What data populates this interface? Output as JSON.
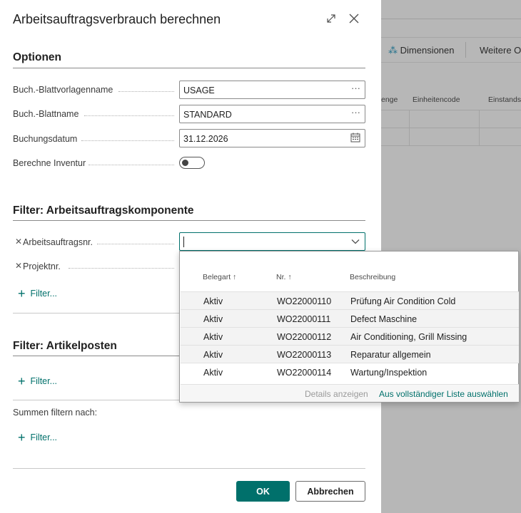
{
  "background": {
    "actions": [
      {
        "icon": "dimensions-icon",
        "label": "Dimensionen"
      },
      {
        "label": "Weitere Op"
      }
    ],
    "grid_headers": [
      "enge",
      "Einheitencode",
      "Einstandsp"
    ]
  },
  "dialog": {
    "title": "Arbeitsauftragsverbrauch berechnen",
    "options": {
      "heading": "Optionen",
      "fields": [
        {
          "label": "Buch.-Blattvorlagenname",
          "value": "USAGE",
          "tail": "···"
        },
        {
          "label": "Buch.-Blattname",
          "value": "STANDARD",
          "tail": "···"
        },
        {
          "label": "Buchungsdatum",
          "value": "31.12.2026"
        },
        {
          "label": "Berechne Inventur",
          "toggle_on": false
        }
      ]
    },
    "filter_component": {
      "heading": "Filter: Arbeitsauftragskomponente",
      "fields": [
        {
          "label": "Arbeitsauftragsnr.",
          "value": ""
        },
        {
          "label": "Projektnr.",
          "value": ""
        }
      ],
      "add_filter": "Filter..."
    },
    "filter_item": {
      "heading": "Filter: Artikelposten",
      "add_filter": "Filter..."
    },
    "totals": {
      "label": "Summen filtern nach:",
      "add_filter": "Filter..."
    },
    "buttons": {
      "ok": "OK",
      "cancel": "Abbrechen"
    }
  },
  "lookup": {
    "columns": [
      {
        "label": "Belegart",
        "sort": "↑"
      },
      {
        "label": "Nr.",
        "sort": "↑"
      },
      {
        "label": "Beschreibung",
        "sort": ""
      }
    ],
    "rows": [
      {
        "type": "Aktiv",
        "no": "WO22000110",
        "desc": "Prüfung Air Condition Cold"
      },
      {
        "type": "Aktiv",
        "no": "WO22000111",
        "desc": "Defect Maschine"
      },
      {
        "type": "Aktiv",
        "no": "WO22000112",
        "desc": "Air Conditioning, Grill Missing"
      },
      {
        "type": "Aktiv",
        "no": "WO22000113",
        "desc": "Reparatur allgemein"
      },
      {
        "type": "Aktiv",
        "no": "WO22000114",
        "desc": "Wartung/Inspektion"
      }
    ],
    "footer": {
      "details": "Details anzeigen",
      "full_list": "Aus vollständiger Liste auswählen"
    }
  },
  "colors": {
    "accent": "#00706b",
    "overlay": "#b7b7b7"
  }
}
